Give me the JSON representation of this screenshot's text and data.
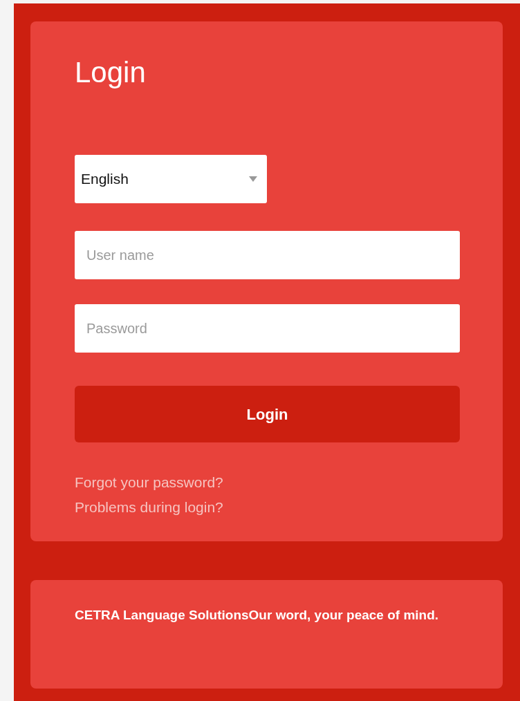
{
  "title": "Login",
  "language_select": {
    "value": "English"
  },
  "username": {
    "placeholder": "User name"
  },
  "password": {
    "placeholder": "Password"
  },
  "login_button": "Login",
  "links": [
    "Forgot your password?",
    "Problems during login?"
  ],
  "footer": "CETRA Language SolutionsOur word, your peace of mind."
}
